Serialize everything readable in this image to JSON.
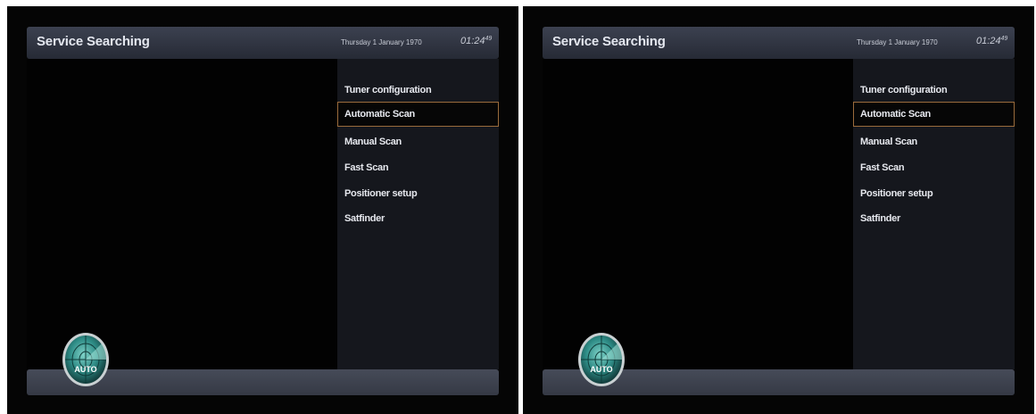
{
  "colors": {
    "title_bar": "#2e323e",
    "menu_bg": "#15171d",
    "selection_border": "#9a6b3c",
    "bottom_bar": "#3d414d",
    "radar_teal": "#2e8c86"
  },
  "screens": [
    {
      "title": "Service Searching",
      "date": "Thursday 1 January 1970",
      "clock": "01:24",
      "clock_seconds": "49",
      "menu": [
        {
          "label": "Tuner configuration"
        },
        {
          "label": "Automatic Scan"
        },
        {
          "label": "Manual Scan"
        },
        {
          "label": "Fast Scan"
        },
        {
          "label": "Positioner setup"
        },
        {
          "label": "Satfinder"
        }
      ],
      "selected_index": 1,
      "icon_label": "AUTO",
      "icon": "radar-auto-icon"
    },
    {
      "title": "Service Searching",
      "date": "Thursday 1 January 1970",
      "clock": "01:24",
      "clock_seconds": "49",
      "menu": [
        {
          "label": "Tuner configuration"
        },
        {
          "label": "Automatic Scan"
        },
        {
          "label": "Manual Scan"
        },
        {
          "label": "Fast Scan"
        },
        {
          "label": "Positioner setup"
        },
        {
          "label": "Satfinder"
        }
      ],
      "selected_index": 1,
      "icon_label": "AUTO",
      "icon": "radar-auto-icon"
    }
  ]
}
